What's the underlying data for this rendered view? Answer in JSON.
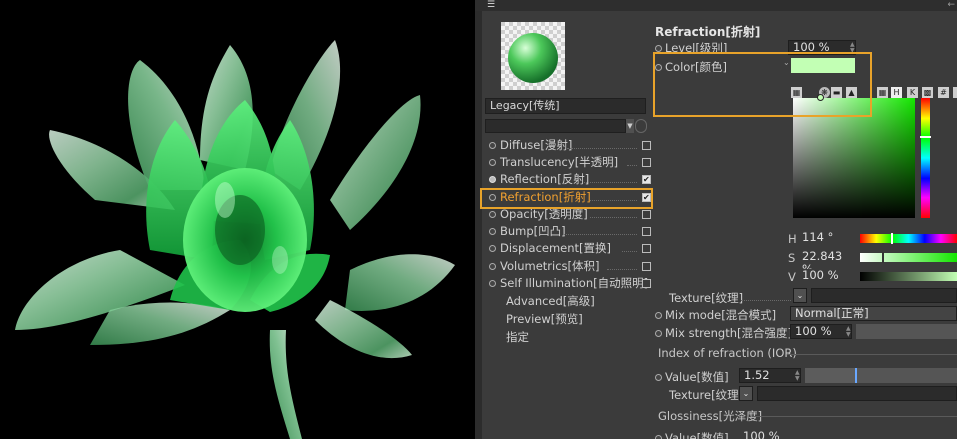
{
  "toolbar": {
    "menu_icon": "menu-icon",
    "back_icon": "back-arrow-icon"
  },
  "material": {
    "name": "Legacy[传统]",
    "channels": [
      {
        "label": "Diffuse[漫射]",
        "checked": false
      },
      {
        "label": "Translucency[半透明]",
        "checked": false
      },
      {
        "label": "Reflection[反射]",
        "checked": true
      },
      {
        "label": "Refraction[折射]",
        "checked": true,
        "active": true
      },
      {
        "label": "Opacity[透明度]",
        "checked": false
      },
      {
        "label": "Bump[凹凸]",
        "checked": false
      },
      {
        "label": "Displacement[置换]",
        "checked": false
      },
      {
        "label": "Volumetrics[体积]",
        "checked": false
      },
      {
        "label": "Self Illumination[自动照明]",
        "checked": false
      }
    ],
    "extras": [
      "Advanced[高级]",
      "Preview[预览]",
      "指定"
    ]
  },
  "refraction": {
    "title": "Refraction[折射]",
    "level_label": "Level[级别]",
    "level_value": "100 %",
    "color_label": "Color[颜色]",
    "color_hex": "#c2ffb4",
    "hsv": {
      "h_label": "H",
      "h_value": "114 °",
      "s_label": "S",
      "s_value": "22.843 %",
      "v_label": "V",
      "v_value": "100 %"
    },
    "texture_label": "Texture[纹理]",
    "mix_mode_label": "Mix mode[混合模式]",
    "mix_mode_value": "Normal[正常]",
    "mix_strength_label": "Mix strength[混合强度]",
    "mix_strength_value": "100 %",
    "ior_heading": "Index of refraction (IOR)",
    "ior_value_label": "Value[数值]",
    "ior_value": "1.52",
    "ior_texture_label": "Texture[纹理]",
    "gloss_heading": "Glossiness[光泽度]",
    "gloss_value_label": "Value[数值]",
    "gloss_value": "100 %"
  },
  "colors": {
    "accent": "#e8a32a",
    "active_text": "#f0a030",
    "panel": "#3b3b3b"
  }
}
